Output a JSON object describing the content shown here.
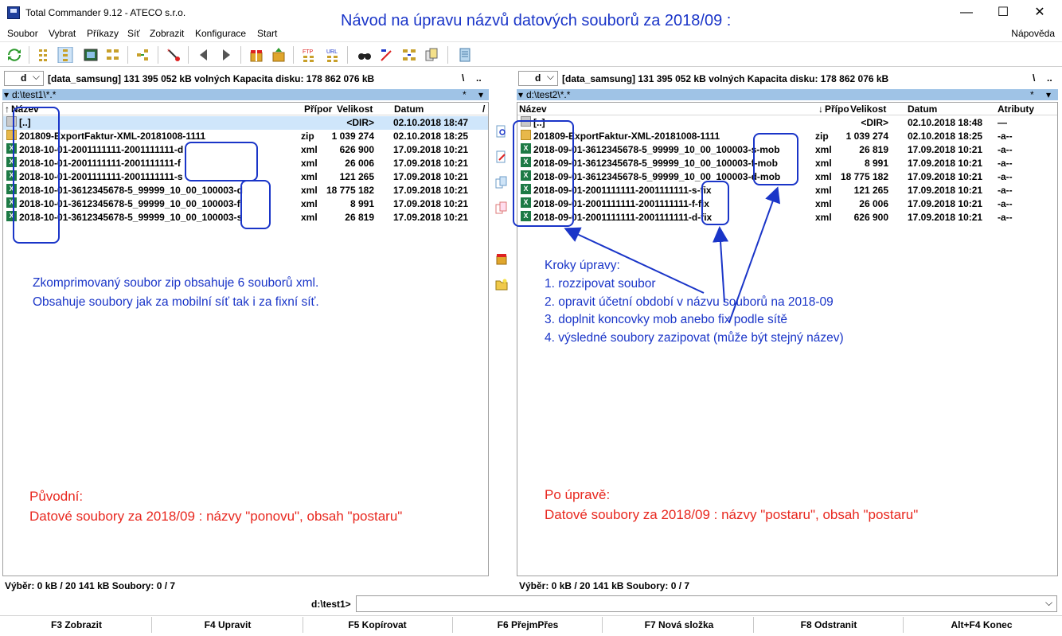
{
  "window": {
    "title": "Total Commander 9.12 - ATECO s.r.o.",
    "headline": "Návod na úpravu názvů datových souborů za 2018/09 :",
    "controls": {
      "minimize": "—",
      "maximize": "☐",
      "close": "✕"
    }
  },
  "menu": {
    "items": [
      "Soubor",
      "Vybrat",
      "Příkazy",
      "Síť",
      "Zobrazit",
      "Konfigurace",
      "Start"
    ],
    "help": "Nápověda"
  },
  "left_panel": {
    "drive": "d",
    "drive_info": "[data_samsung]  131 395 052 kB volných  Kapacita disku: 178 862 076 kB",
    "root_btn": "\\",
    "up_btn": "..",
    "path": "d:\\test1\\*.*",
    "path_star": "*",
    "columns": {
      "name": "Název",
      "ext": "Přípor",
      "size": "Velikost",
      "date": "Datum"
    },
    "sort_indicator": "↑",
    "rows": [
      {
        "name": "[..]",
        "ext": "",
        "size": "<DIR>",
        "date": "02.10.2018 18:47",
        "icon": "up"
      },
      {
        "name": "201809-ExportFaktur-XML-20181008-1111",
        "ext": "zip",
        "size": "1 039 274",
        "date": "02.10.2018 18:25",
        "icon": "zip"
      },
      {
        "name": "2018-10-01-2001111111-2001111111-d",
        "ext": "xml",
        "size": "626 900",
        "date": "17.09.2018 10:21",
        "icon": "xml"
      },
      {
        "name": "2018-10-01-2001111111-2001111111-f",
        "ext": "xml",
        "size": "26 006",
        "date": "17.09.2018 10:21",
        "icon": "xml"
      },
      {
        "name": "2018-10-01-2001111111-2001111111-s",
        "ext": "xml",
        "size": "121 265",
        "date": "17.09.2018 10:21",
        "icon": "xml"
      },
      {
        "name": "2018-10-01-3612345678-5_99999_10_00_100003-d",
        "ext": "xml",
        "size": "18 775 182",
        "date": "17.09.2018 10:21",
        "icon": "xml"
      },
      {
        "name": "2018-10-01-3612345678-5_99999_10_00_100003-f",
        "ext": "xml",
        "size": "8 991",
        "date": "17.09.2018 10:21",
        "icon": "xml"
      },
      {
        "name": "2018-10-01-3612345678-5_99999_10_00_100003-s",
        "ext": "xml",
        "size": "26 819",
        "date": "17.09.2018 10:21",
        "icon": "xml"
      }
    ],
    "status": "Výběr: 0 kB / 20 141 kB  Soubory: 0 / 7"
  },
  "right_panel": {
    "drive": "d",
    "drive_info": "[data_samsung]  131 395 052 kB volných  Kapacita disku: 178 862 076 kB",
    "root_btn": "\\",
    "up_btn": "..",
    "path": "d:\\test2\\*.*",
    "path_star": "*",
    "columns": {
      "name": "Název",
      "ext": "Přípo",
      "size": "Velikost",
      "date": "Datum",
      "attr": "Atributy"
    },
    "sort_indicator": "↓",
    "rows": [
      {
        "name": "[..]",
        "ext": "",
        "size": "<DIR>",
        "date": "02.10.2018 18:48",
        "attr": "—",
        "icon": "up"
      },
      {
        "name": "201809-ExportFaktur-XML-20181008-1111",
        "ext": "zip",
        "size": "1 039 274",
        "date": "02.10.2018 18:25",
        "attr": "-a--",
        "icon": "zip"
      },
      {
        "name": "2018-09-01-3612345678-5_99999_10_00_100003-s-mob",
        "ext": "xml",
        "size": "26 819",
        "date": "17.09.2018 10:21",
        "attr": "-a--",
        "icon": "xml"
      },
      {
        "name": "2018-09-01-3612345678-5_99999_10_00_100003-f-mob",
        "ext": "xml",
        "size": "8 991",
        "date": "17.09.2018 10:21",
        "attr": "-a--",
        "icon": "xml"
      },
      {
        "name": "2018-09-01-3612345678-5_99999_10_00_100003-d-mob",
        "ext": "xml",
        "size": "18 775 182",
        "date": "17.09.2018 10:21",
        "attr": "-a--",
        "icon": "xml"
      },
      {
        "name": "2018-09-01-2001111111-2001111111-s-fix",
        "ext": "xml",
        "size": "121 265",
        "date": "17.09.2018 10:21",
        "attr": "-a--",
        "icon": "xml"
      },
      {
        "name": "2018-09-01-2001111111-2001111111-f-fix",
        "ext": "xml",
        "size": "26 006",
        "date": "17.09.2018 10:21",
        "attr": "-a--",
        "icon": "xml"
      },
      {
        "name": "2018-09-01-2001111111-2001111111-d-fix",
        "ext": "xml",
        "size": "626 900",
        "date": "17.09.2018 10:21",
        "attr": "-a--",
        "icon": "xml"
      }
    ],
    "status": "Výběr: 0 kB / 20 141 kB  Soubory: 0 / 7"
  },
  "notes": {
    "left_blue": [
      "Zkomprimovaný soubor zip obsahuje 6 souborů xml.",
      "Obsahuje soubory jak za mobilní síť tak i za fixní síť."
    ],
    "steps_title": "Kroky úpravy:",
    "steps": [
      "1. rozzipovat soubor",
      "2. opravit účetní období v názvu souborů na 2018-09",
      "3. doplnit koncovky mob anebo fix podle sítě",
      "4. výsledné soubory zazipovat (může být stejný název)"
    ],
    "left_red": [
      "Původní:",
      "Datové soubory za 2018/09 : názvy \"ponovu\", obsah \"postaru\""
    ],
    "right_red": [
      "Po úpravě:",
      "Datové soubory za 2018/09 : názvy \"postaru\", obsah \"postaru\""
    ]
  },
  "command_line": {
    "prompt": "d:\\test1>",
    "value": ""
  },
  "function_keys": [
    "F3 Zobrazit",
    "F4 Upravit",
    "F5 Kopírovat",
    "F6 PřejmPřes",
    "F7 Nová složka",
    "F8 Odstranit",
    "Alt+F4 Konec"
  ],
  "colors": {
    "annotation_blue": "#1a35c8",
    "annotation_red": "#e8281f",
    "path_bar": "#9fc3e6"
  }
}
